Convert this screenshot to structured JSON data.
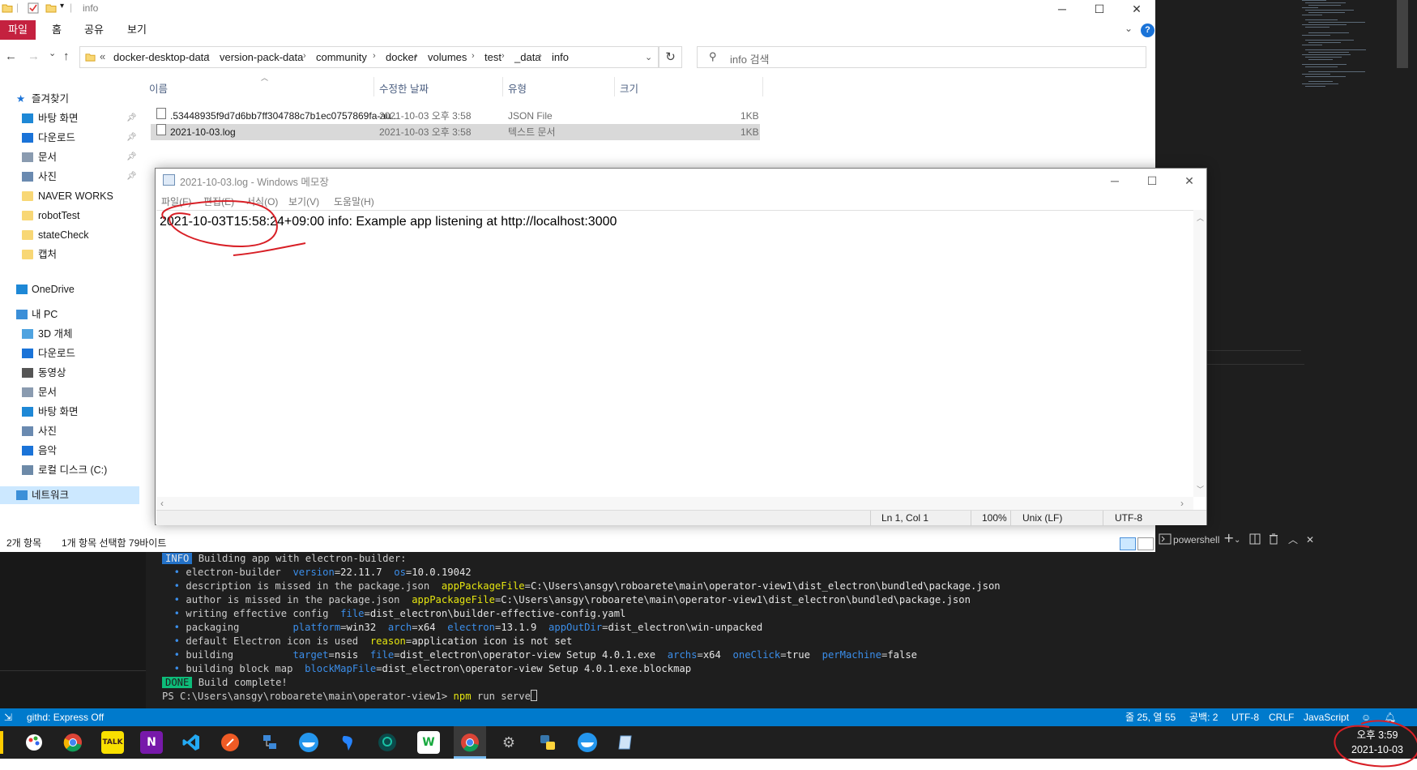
{
  "explorer": {
    "title": "info",
    "ribbon": {
      "file": "파일",
      "home": "홈",
      "share": "공유",
      "view": "보기"
    },
    "help": "?",
    "nav": {
      "back": "←",
      "forward": "→",
      "dropdown": "⌄",
      "up": "↑",
      "refresh": "↻"
    },
    "address": {
      "prefix": "«",
      "crumbs": [
        "docker-desktop-data",
        "version-pack-data",
        "community",
        "docker",
        "volumes",
        "test",
        "_data",
        "info"
      ],
      "separator": "›"
    },
    "search_placeholder": "info 검색",
    "sidebar": [
      {
        "label": "즐겨찾기",
        "root": true
      },
      {
        "label": "바탕 화면",
        "pinned": true
      },
      {
        "label": "다운로드",
        "pinned": true
      },
      {
        "label": "문서",
        "pinned": true
      },
      {
        "label": "사진",
        "pinned": true
      },
      {
        "label": "NAVER WORKS"
      },
      {
        "label": "robotTest"
      },
      {
        "label": "stateCheck"
      },
      {
        "label": "캡처"
      },
      {
        "label": "OneDrive",
        "root": true
      },
      {
        "label": "내 PC",
        "root": true
      },
      {
        "label": "3D 개체"
      },
      {
        "label": "다운로드"
      },
      {
        "label": "동영상"
      },
      {
        "label": "문서"
      },
      {
        "label": "바탕 화면"
      },
      {
        "label": "사진"
      },
      {
        "label": "음악"
      },
      {
        "label": "로컬 디스크 (C:)"
      },
      {
        "label": "네트워크",
        "root": true,
        "selected": true
      }
    ],
    "columns": {
      "name": "이름",
      "modified": "수정한 날짜",
      "type": "유형",
      "size": "크기"
    },
    "files": [
      {
        "name": ".53448935f9d7d6bb7ff304788c7b1ec0757869fa-au...",
        "modified": "2021-10-03 오후 3:58",
        "type": "JSON File",
        "size": "1KB"
      },
      {
        "name": "2021-10-03.log",
        "modified": "2021-10-03 오후 3:58",
        "type": "텍스트 문서",
        "size": "1KB",
        "selected": true
      }
    ],
    "status": {
      "count": "2개 항목",
      "selection": "1개 항목 선택함 79바이트"
    }
  },
  "notepad": {
    "title": "2021-10-03.log - Windows 메모장",
    "menu": {
      "file": "파일(F)",
      "edit": "편집(E)",
      "format": "서식(O)",
      "view": "보기(V)",
      "help": "도움말(H)"
    },
    "content": "2021-10-03T15:58:24+09:00 info: Example app listening at http://localhost:3000",
    "status": {
      "position": "Ln 1, Col 1",
      "zoom": "100%",
      "eol": "Unix (LF)",
      "encoding": "UTF-8"
    }
  },
  "terminal": {
    "shell": "powershell",
    "info_badge": "INFO",
    "info_text": "Building app with electron-builder:",
    "lines": [
      {
        "label": "electron-builder",
        "pairs": [
          [
            "version",
            "22.11.7"
          ],
          [
            "os",
            "10.0.19042"
          ]
        ]
      },
      {
        "label": "description is missed in the package.json",
        "pairs": [
          [
            "appPackageFile",
            "C:\\Users\\ansgy\\roboarete\\main\\operator-view1\\dist_electron\\bundled\\package.json"
          ]
        ],
        "yellow": true
      },
      {
        "label": "author is missed in the package.json",
        "pairs": [
          [
            "appPackageFile",
            "C:\\Users\\ansgy\\roboarete\\main\\operator-view1\\dist_electron\\bundled\\package.json"
          ]
        ],
        "yellow": true
      },
      {
        "label": "writing effective config",
        "pairs": [
          [
            "file",
            "dist_electron\\builder-effective-config.yaml"
          ]
        ]
      },
      {
        "label": "packaging       ",
        "pairs": [
          [
            "platform",
            "win32"
          ],
          [
            "arch",
            "x64"
          ],
          [
            "electron",
            "13.1.9"
          ],
          [
            "appOutDir",
            "dist_electron\\win-unpacked"
          ]
        ]
      },
      {
        "label": "default Electron icon is used",
        "pairs": [
          [
            "reason",
            "application icon is not set"
          ]
        ],
        "yellow": true
      },
      {
        "label": "building        ",
        "pairs": [
          [
            "target",
            "nsis"
          ],
          [
            "file",
            "dist_electron\\operator-view Setup 4.0.1.exe"
          ],
          [
            "archs",
            "x64"
          ],
          [
            "oneClick",
            "true"
          ],
          [
            "perMachine",
            "false"
          ]
        ]
      },
      {
        "label": "building block map",
        "pairs": [
          [
            "blockMapFile",
            "dist_electron\\operator-view Setup 4.0.1.exe.blockmap"
          ]
        ]
      }
    ],
    "done_badge": "DONE",
    "done_text": "Build complete!",
    "prompt": "PS C:\\Users\\ansgy\\roboarete\\main\\operator-view1>",
    "command": "npm",
    "command_args": "run serve"
  },
  "statusbar": {
    "remote": "githd: Express Off",
    "position": "줄 25, 열 55",
    "spaces": "공백: 2",
    "encoding": "UTF-8",
    "eol": "CRLF",
    "language": "JavaScript"
  },
  "taskbar": {
    "clock_time": "오후 3:59",
    "clock_date": "2021-10-03",
    "apps": [
      "paint-icon",
      "chrome-icon",
      "kakaotalk-icon",
      "onenote-icon",
      "vscode-icon",
      "postman-icon",
      "network-icon",
      "docker-icon",
      "sourcetree-icon",
      "gitkraken-icon",
      "naver-works-icon",
      "chrome-dev-icon",
      "settings-icon",
      "python-icon",
      "docker-desktop-icon",
      "notepad-icon"
    ]
  }
}
